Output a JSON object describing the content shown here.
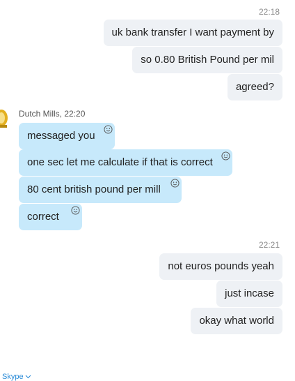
{
  "chat": {
    "timestamp_1": "22:18",
    "outgoing_1": [
      "uk bank transfer I want payment by",
      "so 0.80 British Pound per mil",
      "agreed?"
    ],
    "sender_name": "Dutch Mills, 22:20",
    "incoming": [
      "messaged you",
      "one sec let me calculate if that is correct",
      "80 cent british pound per mill",
      "correct"
    ],
    "timestamp_2": "22:21",
    "outgoing_2": [
      "not euros pounds yeah",
      "just incase",
      "okay what world"
    ]
  },
  "footer": {
    "label": "Skype"
  },
  "colors": {
    "incoming_bubble": "#c7e9fb",
    "outgoing_bubble": "#eef1f5",
    "timestamp": "#8a8a8a",
    "link": "#2a8bd8"
  },
  "icons": {
    "reaction": "smiley-icon",
    "avatar": "avatar-icon",
    "dropdown": "chevron-down-icon"
  }
}
